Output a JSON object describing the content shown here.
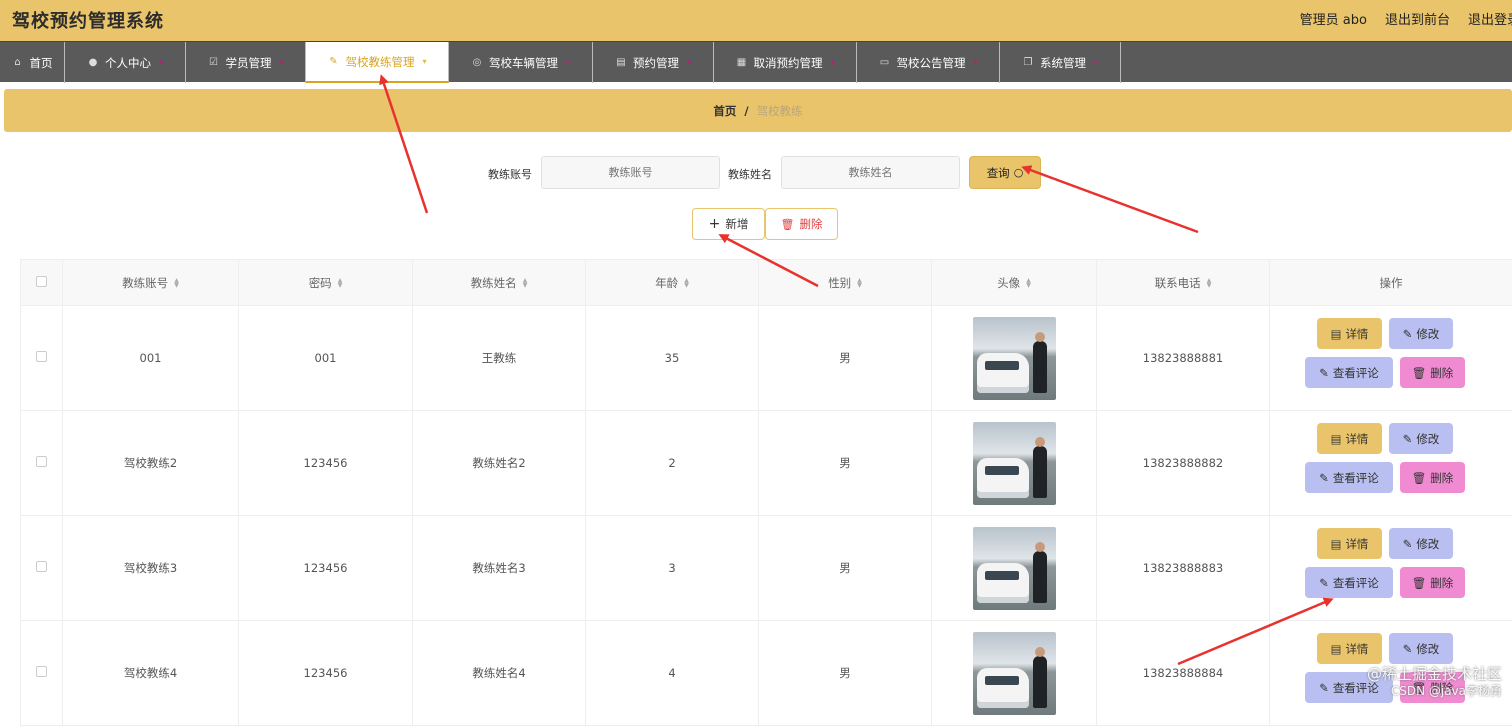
{
  "header": {
    "title": "驾校预约管理系统",
    "user": "管理员 abo",
    "to_front": "退出到前台",
    "logout": "退出登录"
  },
  "nav": [
    {
      "label": "首页",
      "icon": "home-icon",
      "active": false
    },
    {
      "label": "个人中心",
      "icon": "user-icon",
      "active": false
    },
    {
      "label": "学员管理",
      "icon": "checkbox-icon",
      "active": false
    },
    {
      "label": "驾校教练管理",
      "icon": "edit-icon",
      "active": true
    },
    {
      "label": "驾校车辆管理",
      "icon": "compass-icon",
      "active": false
    },
    {
      "label": "预约管理",
      "icon": "briefcase-icon",
      "active": false
    },
    {
      "label": "取消预约管理",
      "icon": "document-icon",
      "active": false
    },
    {
      "label": "驾校公告管理",
      "icon": "monitor-icon",
      "active": false
    },
    {
      "label": "系统管理",
      "icon": "copy-icon",
      "active": false
    }
  ],
  "breadcrumb": {
    "home": "首页",
    "separator": "/",
    "current": "驾校教练"
  },
  "search": {
    "account_label": "教练账号",
    "account_placeholder": "教练账号",
    "name_label": "教练姓名",
    "name_placeholder": "教练姓名",
    "query_label": "查询"
  },
  "actions": {
    "add_label": "新增",
    "delete_label": "删除"
  },
  "table": {
    "columns": [
      "教练账号",
      "密码",
      "教练姓名",
      "年龄",
      "性别",
      "头像",
      "联系电话",
      "操作"
    ],
    "rows": [
      {
        "account": "001",
        "password": "001",
        "name": "王教练",
        "age": "35",
        "gender": "男",
        "phone": "13823888881"
      },
      {
        "account": "驾校教练2",
        "password": "123456",
        "name": "教练姓名2",
        "age": "2",
        "gender": "男",
        "phone": "13823888882"
      },
      {
        "account": "驾校教练3",
        "password": "123456",
        "name": "教练姓名3",
        "age": "3",
        "gender": "男",
        "phone": "13823888883"
      },
      {
        "account": "驾校教练4",
        "password": "123456",
        "name": "教练姓名4",
        "age": "4",
        "gender": "男",
        "phone": "13823888884"
      }
    ],
    "ops": {
      "detail": "详情",
      "edit": "修改",
      "comment": "查看评论",
      "delete": "删除"
    }
  },
  "watermark": {
    "line1": "@稀土掘金技术社区",
    "line2": "CSDN @java李杨勇"
  },
  "colors": {
    "accent": "#e9c46a",
    "nav_bg": "#5a5a5a",
    "edit": "#b9bff0",
    "delete": "#f08ad1",
    "arrow": "#e8322d"
  }
}
